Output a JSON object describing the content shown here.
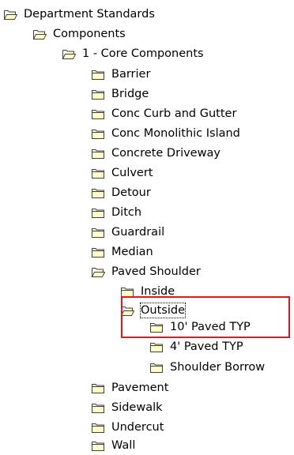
{
  "tree": {
    "items": [
      {
        "label": "Department Standards",
        "expanded": true,
        "icon": "folder-open-icon"
      },
      {
        "label": "Components",
        "expanded": true,
        "icon": "folder-open-icon"
      },
      {
        "label": "1 - Core Components",
        "expanded": true,
        "icon": "folder-open-icon"
      },
      {
        "label": "Barrier",
        "expanded": false,
        "icon": "folder-closed-icon"
      },
      {
        "label": "Bridge",
        "expanded": false,
        "icon": "folder-closed-icon"
      },
      {
        "label": "Conc Curb and Gutter",
        "expanded": false,
        "icon": "folder-closed-icon"
      },
      {
        "label": "Conc Monolithic Island",
        "expanded": false,
        "icon": "folder-closed-icon"
      },
      {
        "label": "Concrete Driveway",
        "expanded": false,
        "icon": "folder-closed-icon"
      },
      {
        "label": "Culvert",
        "expanded": false,
        "icon": "folder-closed-icon"
      },
      {
        "label": "Detour",
        "expanded": false,
        "icon": "folder-closed-icon"
      },
      {
        "label": "Ditch",
        "expanded": false,
        "icon": "folder-closed-icon"
      },
      {
        "label": "Guardrail",
        "expanded": false,
        "icon": "folder-closed-icon"
      },
      {
        "label": "Median",
        "expanded": false,
        "icon": "folder-closed-icon"
      },
      {
        "label": "Paved Shoulder",
        "expanded": true,
        "icon": "folder-open-icon"
      },
      {
        "label": "Inside",
        "expanded": false,
        "icon": "folder-closed-icon"
      },
      {
        "label": "Outside",
        "expanded": true,
        "icon": "folder-open-icon",
        "focused": true
      },
      {
        "label": "10' Paved TYP",
        "expanded": false,
        "icon": "folder-closed-icon"
      },
      {
        "label": "4' Paved TYP",
        "expanded": false,
        "icon": "folder-closed-icon"
      },
      {
        "label": "Shoulder Borrow",
        "expanded": false,
        "icon": "folder-closed-icon"
      },
      {
        "label": "Pavement",
        "expanded": false,
        "icon": "folder-closed-icon"
      },
      {
        "label": "Sidewalk",
        "expanded": false,
        "icon": "folder-closed-icon"
      },
      {
        "label": "Undercut",
        "expanded": false,
        "icon": "folder-closed-icon"
      },
      {
        "label": "Wall",
        "expanded": false,
        "icon": "folder-closed-icon"
      }
    ]
  },
  "colors": {
    "folder_fill": "#ffffcc",
    "folder_tab": "#fff2a8",
    "folder_outline": "#404040",
    "highlight_border": "#e8121c"
  }
}
